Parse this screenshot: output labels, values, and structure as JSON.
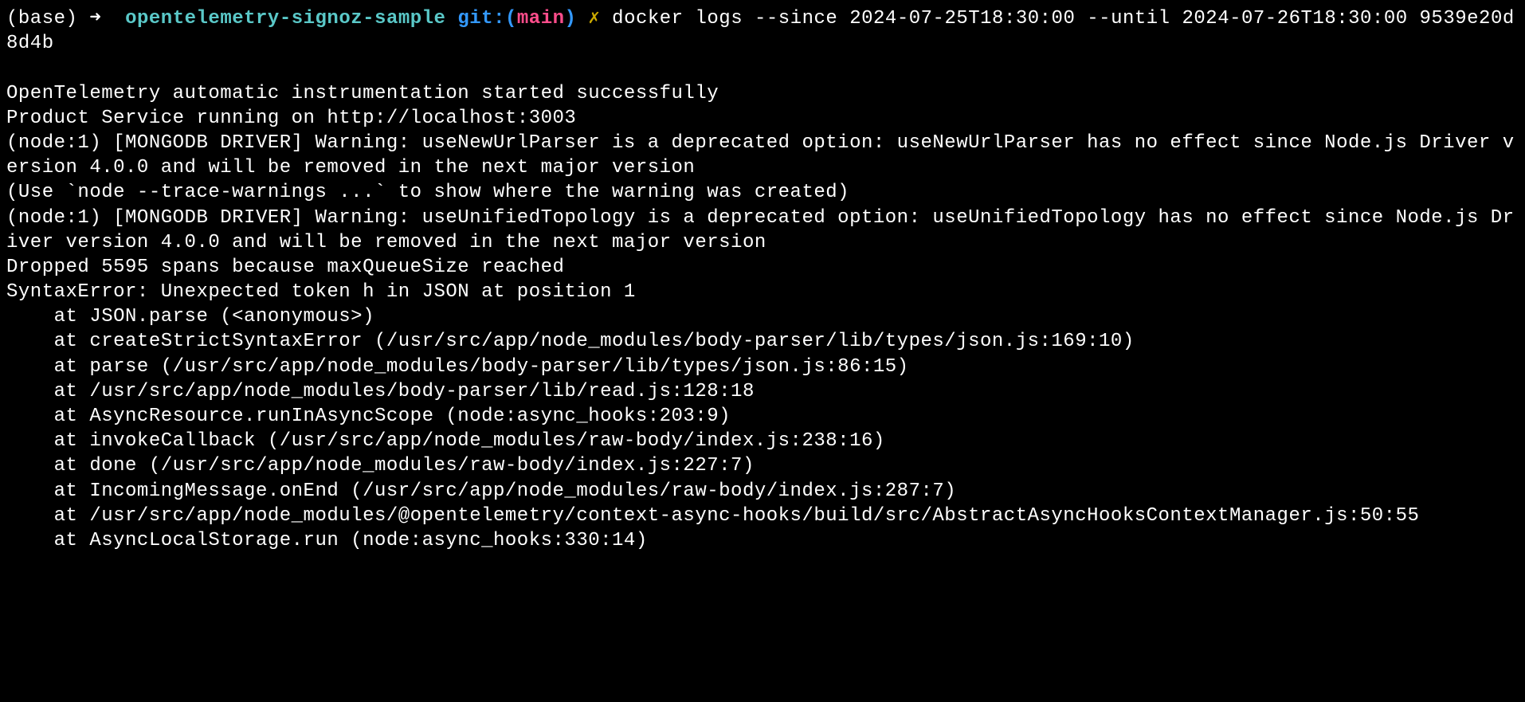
{
  "prompt": {
    "base": "(base)",
    "arrow": "➜",
    "dir": "opentelemetry-signoz-sample",
    "git_label": "git:(",
    "branch": "main",
    "git_close": ")",
    "dirty": "✗"
  },
  "command": "docker logs --since 2024-07-25T18:30:00 --until 2024-07-26T18:30:00 9539e20d8d4b",
  "output_lines": [
    "",
    "OpenTelemetry automatic instrumentation started successfully",
    "Product Service running on http://localhost:3003",
    "(node:1) [MONGODB DRIVER] Warning: useNewUrlParser is a deprecated option: useNewUrlParser has no effect since Node.js Driver version 4.0.0 and will be removed in the next major version",
    "(Use `node --trace-warnings ...` to show where the warning was created)",
    "(node:1) [MONGODB DRIVER] Warning: useUnifiedTopology is a deprecated option: useUnifiedTopology has no effect since Node.js Driver version 4.0.0 and will be removed in the next major version",
    "Dropped 5595 spans because maxQueueSize reached",
    "SyntaxError: Unexpected token h in JSON at position 1",
    "    at JSON.parse (<anonymous>)",
    "    at createStrictSyntaxError (/usr/src/app/node_modules/body-parser/lib/types/json.js:169:10)",
    "    at parse (/usr/src/app/node_modules/body-parser/lib/types/json.js:86:15)",
    "    at /usr/src/app/node_modules/body-parser/lib/read.js:128:18",
    "    at AsyncResource.runInAsyncScope (node:async_hooks:203:9)",
    "    at invokeCallback (/usr/src/app/node_modules/raw-body/index.js:238:16)",
    "    at done (/usr/src/app/node_modules/raw-body/index.js:227:7)",
    "    at IncomingMessage.onEnd (/usr/src/app/node_modules/raw-body/index.js:287:7)",
    "    at /usr/src/app/node_modules/@opentelemetry/context-async-hooks/build/src/AbstractAsyncHooksContextManager.js:50:55",
    "    at AsyncLocalStorage.run (node:async_hooks:330:14)"
  ]
}
